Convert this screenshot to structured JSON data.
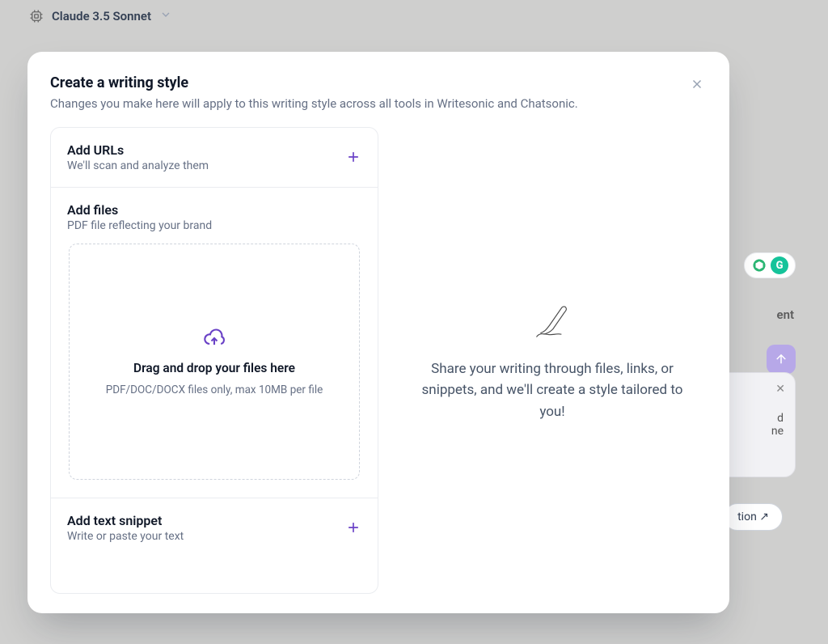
{
  "topbar": {
    "model_label": "Claude 3.5 Sonnet"
  },
  "modal": {
    "title": "Create a writing style",
    "subtitle": "Changes you make here will apply to this writing style across all tools in Writesonic and Chatsonic.",
    "sections": {
      "urls": {
        "title": "Add URLs",
        "subtitle": "We'll scan and analyze them"
      },
      "files": {
        "title": "Add files",
        "subtitle": "PDF file reflecting your brand",
        "dropzone": {
          "title": "Drag and drop your files here",
          "hint": "PDF/DOC/DOCX files only, max 10MB per file"
        }
      },
      "text_snippet": {
        "title": "Add text snippet",
        "subtitle": "Write or paste your text"
      }
    },
    "placeholder": {
      "text": "Share your writing through files, links, or snippets, and we'll create a style tailored to you!"
    }
  },
  "background": {
    "side_text_fragment_1": "ent",
    "card_fragment_1": "d",
    "card_fragment_2": "ne",
    "pill_fragment": "tion ↗",
    "grammarly_letter": "G"
  }
}
